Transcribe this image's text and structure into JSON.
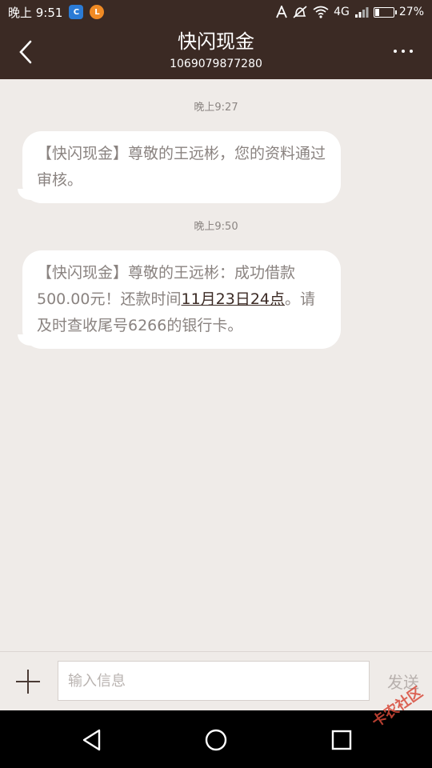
{
  "status_bar": {
    "time": "晚上 9:51",
    "network": "4G",
    "battery_percent": "27%",
    "battery_level": 0.27,
    "icons": [
      "app-blue-icon",
      "app-orange-icon",
      "font-a-icon",
      "mute-icon",
      "wifi-icon",
      "signal-icon",
      "battery-icon"
    ],
    "blue_icon_letter": "C",
    "orange_icon_letter": "L"
  },
  "header": {
    "title": "快闪现金",
    "subtitle": "1069079877280"
  },
  "messages": [
    {
      "time": "晚上9:27",
      "text": "【快闪现金】尊敬的王远彬，您的资料通过审核。"
    },
    {
      "time": "晚上9:50",
      "text_before": "【快闪现金】尊敬的王远彬：成功借款500.00元！还款时间",
      "text_link": "11月23日24点",
      "text_after": "。请及时查收尾号6266的银行卡。"
    }
  ],
  "input_bar": {
    "placeholder": "输入信息",
    "send_label": "发送"
  },
  "watermark": "卡农社区",
  "colors": {
    "header_bg": "#3b2a24",
    "background": "#efebe8",
    "bubble_bg": "#ffffff",
    "bubble_text": "#8a8380"
  }
}
